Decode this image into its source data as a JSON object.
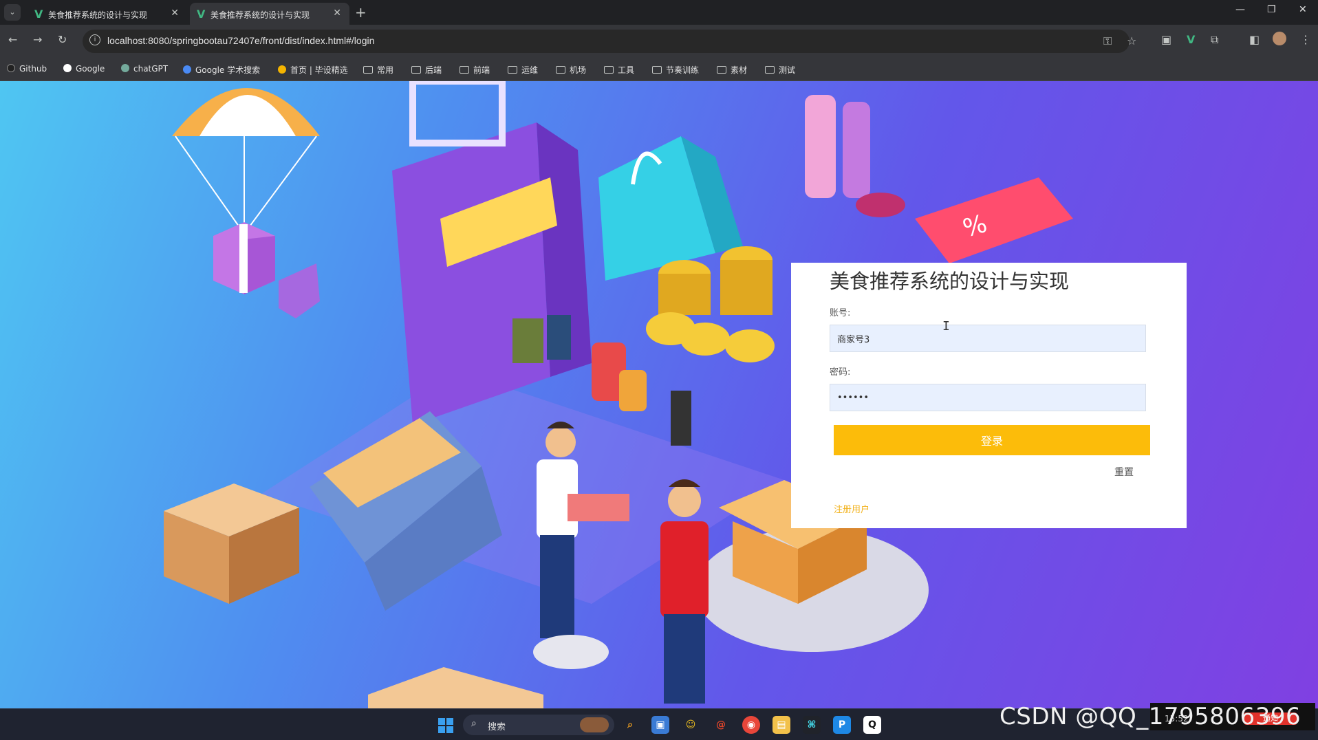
{
  "browser": {
    "tabs": [
      {
        "title": "美食推荐系统的设计与实现",
        "active": false
      },
      {
        "title": "美食推荐系统的设计与实现",
        "active": true
      }
    ],
    "new_tab_icon": "plus-icon",
    "url": "localhost:8080/springbootau72407e/front/dist/index.html#/login",
    "bookmarks": [
      {
        "label": "Github",
        "icon": "github-icon"
      },
      {
        "label": "Google",
        "icon": "google-icon"
      },
      {
        "label": "chatGPT",
        "icon": "chatgpt-icon"
      },
      {
        "label": "Google 学术搜索",
        "icon": "scholar-icon"
      },
      {
        "label": "首页 | 毕设精选",
        "icon": "site-icon"
      },
      {
        "label": "常用",
        "icon": "folder-icon"
      },
      {
        "label": "后端",
        "icon": "folder-icon"
      },
      {
        "label": "前端",
        "icon": "folder-icon"
      },
      {
        "label": "运维",
        "icon": "folder-icon"
      },
      {
        "label": "机场",
        "icon": "folder-icon"
      },
      {
        "label": "工具",
        "icon": "folder-icon"
      },
      {
        "label": "节奏训练",
        "icon": "folder-icon"
      },
      {
        "label": "素材",
        "icon": "folder-icon"
      },
      {
        "label": "测试",
        "icon": "folder-icon"
      }
    ]
  },
  "login": {
    "title": "美食推荐系统的设计与实现",
    "account_label": "账号:",
    "account_value": "商家号3",
    "password_label": "密码:",
    "password_value": "••••••",
    "login_button": "登录",
    "reset_link": "重置",
    "register_link": "注册用户"
  },
  "taskbar": {
    "search_placeholder": "搜索",
    "apps": [
      "search-app-icon",
      "remote-desktop-icon",
      "chat-icon",
      "snail-icon",
      "chrome-icon",
      "file-explorer-icon",
      "ide-icon",
      "p-app-icon",
      "qq-icon"
    ],
    "clock": "15:52",
    "notification": "通知"
  },
  "watermark": "CSDN @QQ_1795806396",
  "colors": {
    "accent_button": "#fcbc0a",
    "register_link": "#f2b21c",
    "background_start": "#4fc6f2",
    "background_end": "#8040e2"
  }
}
